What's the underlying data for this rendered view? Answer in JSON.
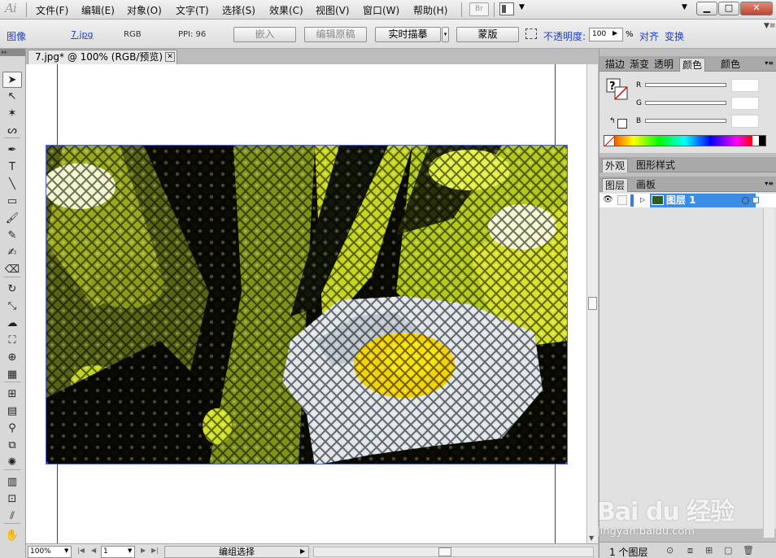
{
  "app": {
    "logo": "Ai",
    "menus": [
      "文件(F)",
      "编辑(E)",
      "对象(O)",
      "文字(T)",
      "选择(S)",
      "效果(C)",
      "视图(V)",
      "窗口(W)",
      "帮助(H)"
    ],
    "bridge_label": "Br",
    "window_buttons": {
      "minimize": "▁",
      "maximize": "□",
      "close": "✕"
    }
  },
  "control_bar": {
    "object_type": "图像",
    "filename_link": "7.jpg",
    "color_mode": "RGB",
    "ppi": "PPI: 96",
    "embed_button": "嵌入",
    "edit_original_button": "编辑原稿",
    "live_trace_button": "实时描摹",
    "mask_button": "蒙版",
    "opacity_label": "不透明度:",
    "opacity_value": "100",
    "opacity_unit": "%",
    "align_link": "对齐",
    "transform_link": "变换"
  },
  "document": {
    "tab_title": "7.jpg* @ 100% (RGB/预览)",
    "tab_close": "✕"
  },
  "tools": [
    {
      "name": "selection-tool",
      "glyph": "➤"
    },
    {
      "name": "direct-selection-tool",
      "glyph": "↖"
    },
    {
      "name": "magic-wand-tool",
      "glyph": "✶"
    },
    {
      "name": "lasso-tool",
      "glyph": "ᔕ"
    },
    {
      "name": "pen-tool",
      "glyph": "✒"
    },
    {
      "name": "type-tool",
      "glyph": "T"
    },
    {
      "name": "line-segment-tool",
      "glyph": "╲"
    },
    {
      "name": "rectangle-tool",
      "glyph": "▭"
    },
    {
      "name": "paintbrush-tool",
      "glyph": "🖌"
    },
    {
      "name": "pencil-tool",
      "glyph": "✎"
    },
    {
      "name": "blob-brush-tool",
      "glyph": "✍"
    },
    {
      "name": "eraser-tool",
      "glyph": "⌫"
    },
    {
      "name": "rotate-tool",
      "glyph": "↻"
    },
    {
      "name": "scale-tool",
      "glyph": "⤡"
    },
    {
      "name": "warp-tool",
      "glyph": "☁"
    },
    {
      "name": "free-transform-tool",
      "glyph": "⛶"
    },
    {
      "name": "shape-builder-tool",
      "glyph": "⊕"
    },
    {
      "name": "perspective-grid-tool",
      "glyph": "▦"
    },
    {
      "name": "mesh-tool",
      "glyph": "⊞"
    },
    {
      "name": "gradient-tool",
      "glyph": "▤"
    },
    {
      "name": "eyedropper-tool",
      "glyph": "⚲"
    },
    {
      "name": "blend-tool",
      "glyph": "⧉"
    },
    {
      "name": "symbol-sprayer-tool",
      "glyph": "✺"
    },
    {
      "name": "column-graph-tool",
      "glyph": "▥"
    },
    {
      "name": "artboard-tool",
      "glyph": "⊡"
    },
    {
      "name": "slice-tool",
      "glyph": "⫽"
    },
    {
      "name": "hand-tool",
      "glyph": "✋"
    }
  ],
  "status_bar": {
    "zoom": "100%",
    "page": "1",
    "status": "编组选择"
  },
  "color_panel": {
    "tabs": [
      "描边",
      "渐变",
      "透明度",
      "颜色",
      "颜色"
    ],
    "channels": [
      {
        "label": "R",
        "value": ""
      },
      {
        "label": "G",
        "value": ""
      },
      {
        "label": "B",
        "value": ""
      }
    ]
  },
  "appearance_panel": {
    "tabs": [
      "外观",
      "图形样式"
    ]
  },
  "layers_panel": {
    "tabs": [
      "图层",
      "画板"
    ],
    "layers": [
      {
        "name": "图层 1",
        "color": "#3a7be0"
      }
    ],
    "footer_count": "1 个图层"
  },
  "watermark": {
    "logo": "Bai du 经验",
    "url": "jingyan.baidu.com"
  }
}
